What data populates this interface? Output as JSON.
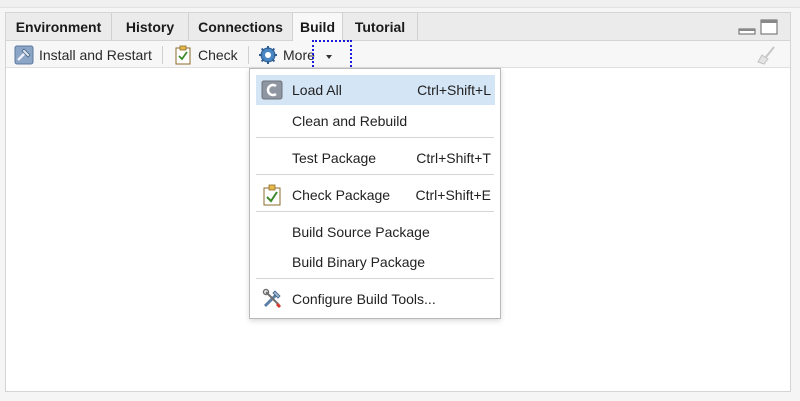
{
  "tabs": [
    {
      "label": "Environment",
      "active": false
    },
    {
      "label": "History",
      "active": false
    },
    {
      "label": "Connections",
      "active": false
    },
    {
      "label": "Build",
      "active": true
    },
    {
      "label": "Tutorial",
      "active": false
    }
  ],
  "toolbar": {
    "install_label": "Install and Restart",
    "check_label": "Check",
    "more_label": "More"
  },
  "menu": {
    "items": [
      {
        "label": "Load All",
        "shortcut": "Ctrl+Shift+L",
        "icon": "load-all-icon"
      },
      {
        "label": "Clean and Rebuild",
        "shortcut": ""
      },
      {
        "label": "Test Package",
        "shortcut": "Ctrl+Shift+T"
      },
      {
        "label": "Check Package",
        "shortcut": "Ctrl+Shift+E",
        "icon": "checklist-icon"
      },
      {
        "label": "Build Source Package",
        "shortcut": ""
      },
      {
        "label": "Build Binary Package",
        "shortcut": ""
      },
      {
        "label": "Configure Build Tools...",
        "shortcut": "",
        "icon": "tools-icon"
      }
    ]
  },
  "colors": {
    "highlight": "#d4e5f6",
    "focus_outline": "#1a1adb"
  }
}
